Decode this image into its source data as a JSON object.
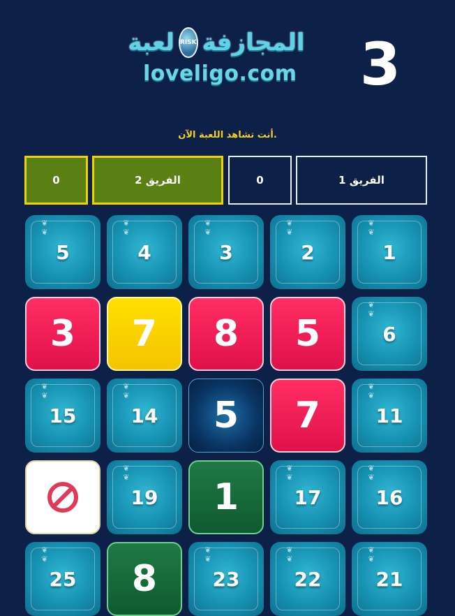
{
  "header": {
    "logo_text": "لعبة المجازفة",
    "logo_badge": "RISK",
    "site": "loveligo.com",
    "round": "3"
  },
  "status_text": "أنت تشاهد اللعبة الآن.",
  "teams": [
    {
      "name": "الفريق 1",
      "score": "0",
      "active": false
    },
    {
      "name": "الفريق 2",
      "score": "0",
      "active": true
    }
  ],
  "board": {
    "tiles": [
      {
        "label": "1",
        "kind": "num"
      },
      {
        "label": "2",
        "kind": "num"
      },
      {
        "label": "3",
        "kind": "num"
      },
      {
        "label": "4",
        "kind": "num"
      },
      {
        "label": "5",
        "kind": "num"
      },
      {
        "label": "6",
        "kind": "num"
      },
      {
        "label": "5",
        "kind": "red"
      },
      {
        "label": "8",
        "kind": "red"
      },
      {
        "label": "7",
        "kind": "yellow"
      },
      {
        "label": "3",
        "kind": "red"
      },
      {
        "label": "11",
        "kind": "num"
      },
      {
        "label": "7",
        "kind": "red"
      },
      {
        "label": "5",
        "kind": "blue"
      },
      {
        "label": "14",
        "kind": "num"
      },
      {
        "label": "15",
        "kind": "num"
      },
      {
        "label": "16",
        "kind": "num"
      },
      {
        "label": "17",
        "kind": "num"
      },
      {
        "label": "1",
        "kind": "green"
      },
      {
        "label": "19",
        "kind": "num"
      },
      {
        "label": "",
        "kind": "white",
        "icon": "prohibited-icon"
      },
      {
        "label": "21",
        "kind": "num"
      },
      {
        "label": "22",
        "kind": "num"
      },
      {
        "label": "23",
        "kind": "num"
      },
      {
        "label": "8",
        "kind": "green"
      },
      {
        "label": "25",
        "kind": "num"
      }
    ]
  }
}
